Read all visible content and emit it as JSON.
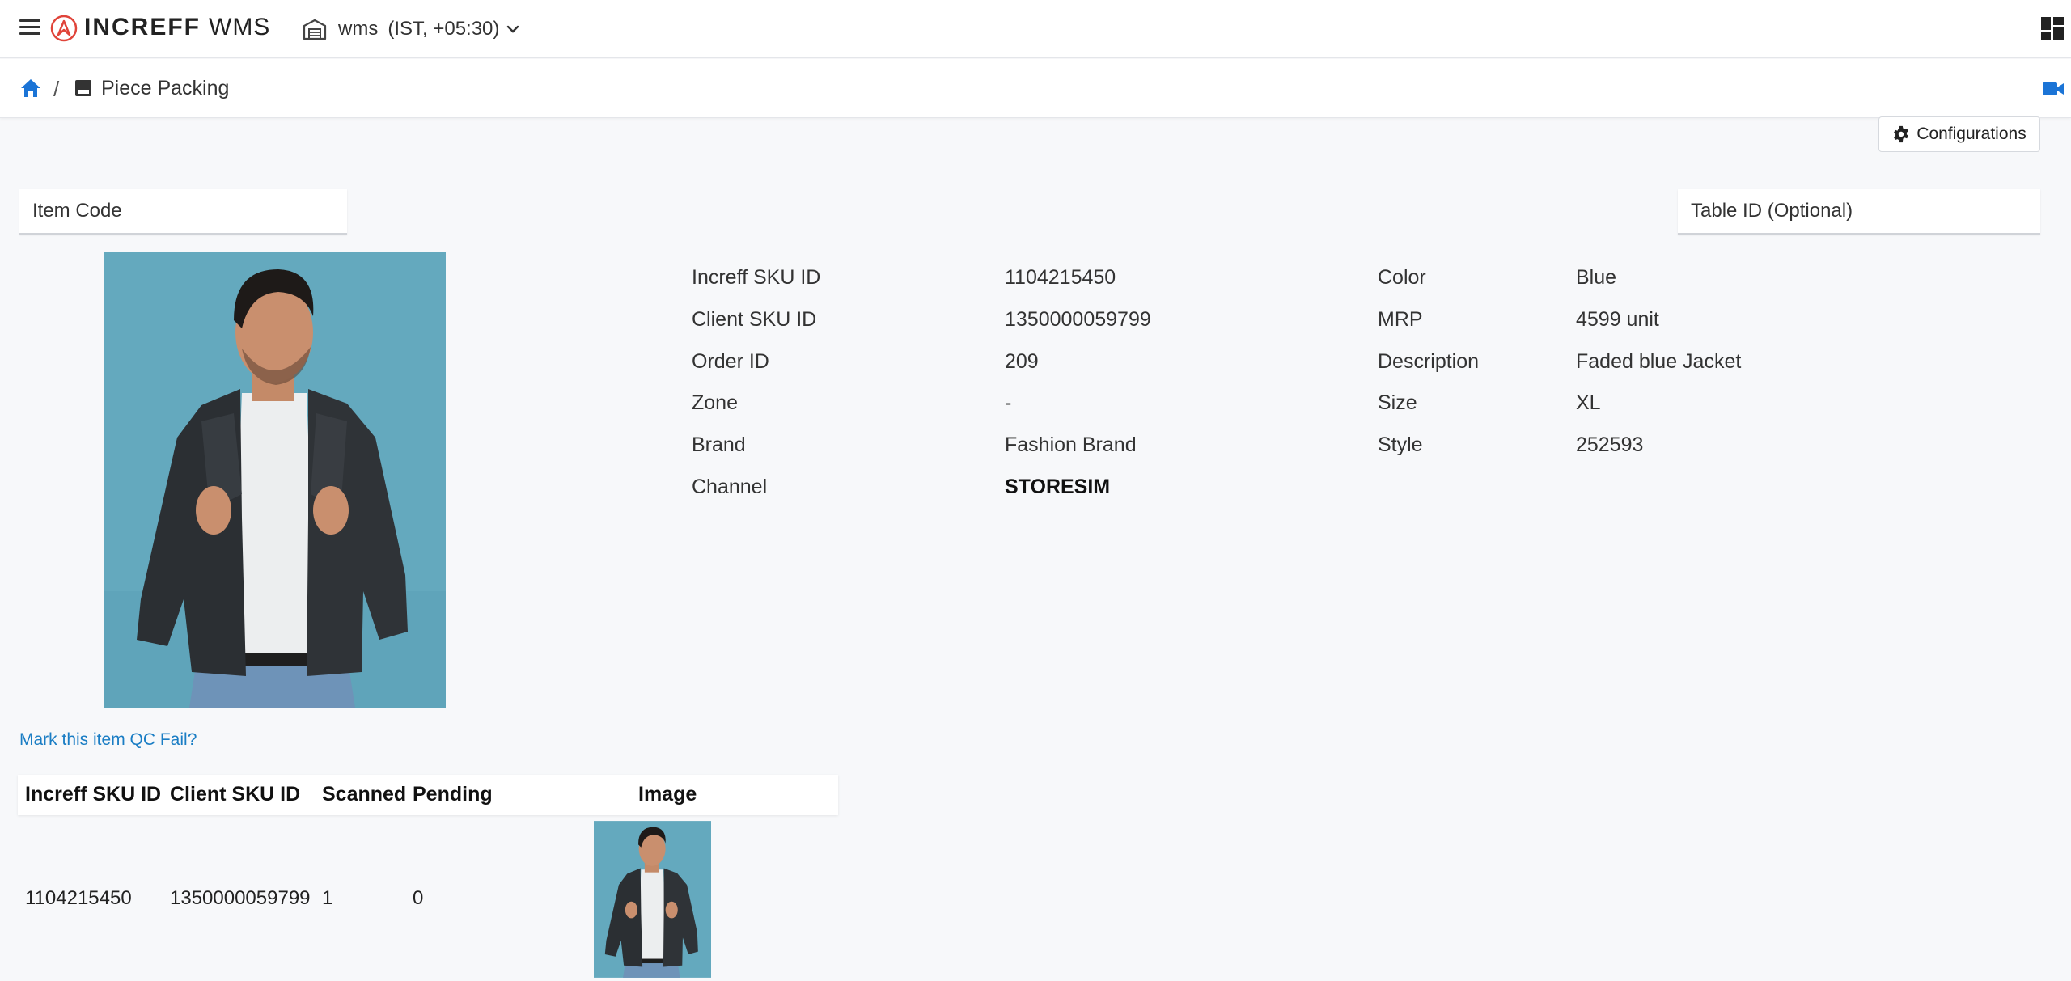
{
  "app": {
    "logo_brand": "INCREFF",
    "logo_product": "WMS",
    "warehouse_name": "wms",
    "warehouse_timezone": "(IST, +05:30)",
    "brand_color": "#e0443a"
  },
  "breadcrumb": {
    "page_title": "Piece Packing"
  },
  "toolbar": {
    "configurations_label": "Configurations"
  },
  "inputs": {
    "item_code_placeholder": "Item Code",
    "table_id_placeholder": "Table ID (Optional)"
  },
  "details": {
    "left": [
      {
        "label": "Increff SKU ID",
        "value": "1104215450"
      },
      {
        "label": "Client SKU ID",
        "value": "1350000059799"
      },
      {
        "label": "Order ID",
        "value": "209"
      },
      {
        "label": "Zone",
        "value": "-"
      },
      {
        "label": "Brand",
        "value": "Fashion Brand"
      },
      {
        "label": "Channel",
        "value": "STORESIM"
      }
    ],
    "right": [
      {
        "label": "Color",
        "value": "Blue"
      },
      {
        "label": "MRP",
        "value": "4599 unit"
      },
      {
        "label": "Description",
        "value": "Faded blue Jacket"
      },
      {
        "label": "Size",
        "value": "XL"
      },
      {
        "label": "Style",
        "value": "252593"
      }
    ]
  },
  "qc_fail_link": "Mark this item QC Fail?",
  "table": {
    "headers": [
      "Increff SKU ID",
      "Client SKU ID",
      "Scanned",
      "Pending",
      "Image"
    ],
    "rows": [
      {
        "increff_sku": "1104215450",
        "client_sku": "1350000059799",
        "scanned": "1",
        "pending": "0"
      }
    ]
  },
  "icons": {
    "menu": "hamburger-icon",
    "logo": "increff-logo-icon",
    "warehouse": "warehouse-icon",
    "apps": "apps-grid-icon",
    "home": "home-icon",
    "page": "page-icon",
    "video": "video-camera-icon",
    "settings": "gear-icon"
  },
  "colors": {
    "link": "#1a7dc4",
    "home_icon": "#1b74d6",
    "image_background": "#64a9be"
  }
}
